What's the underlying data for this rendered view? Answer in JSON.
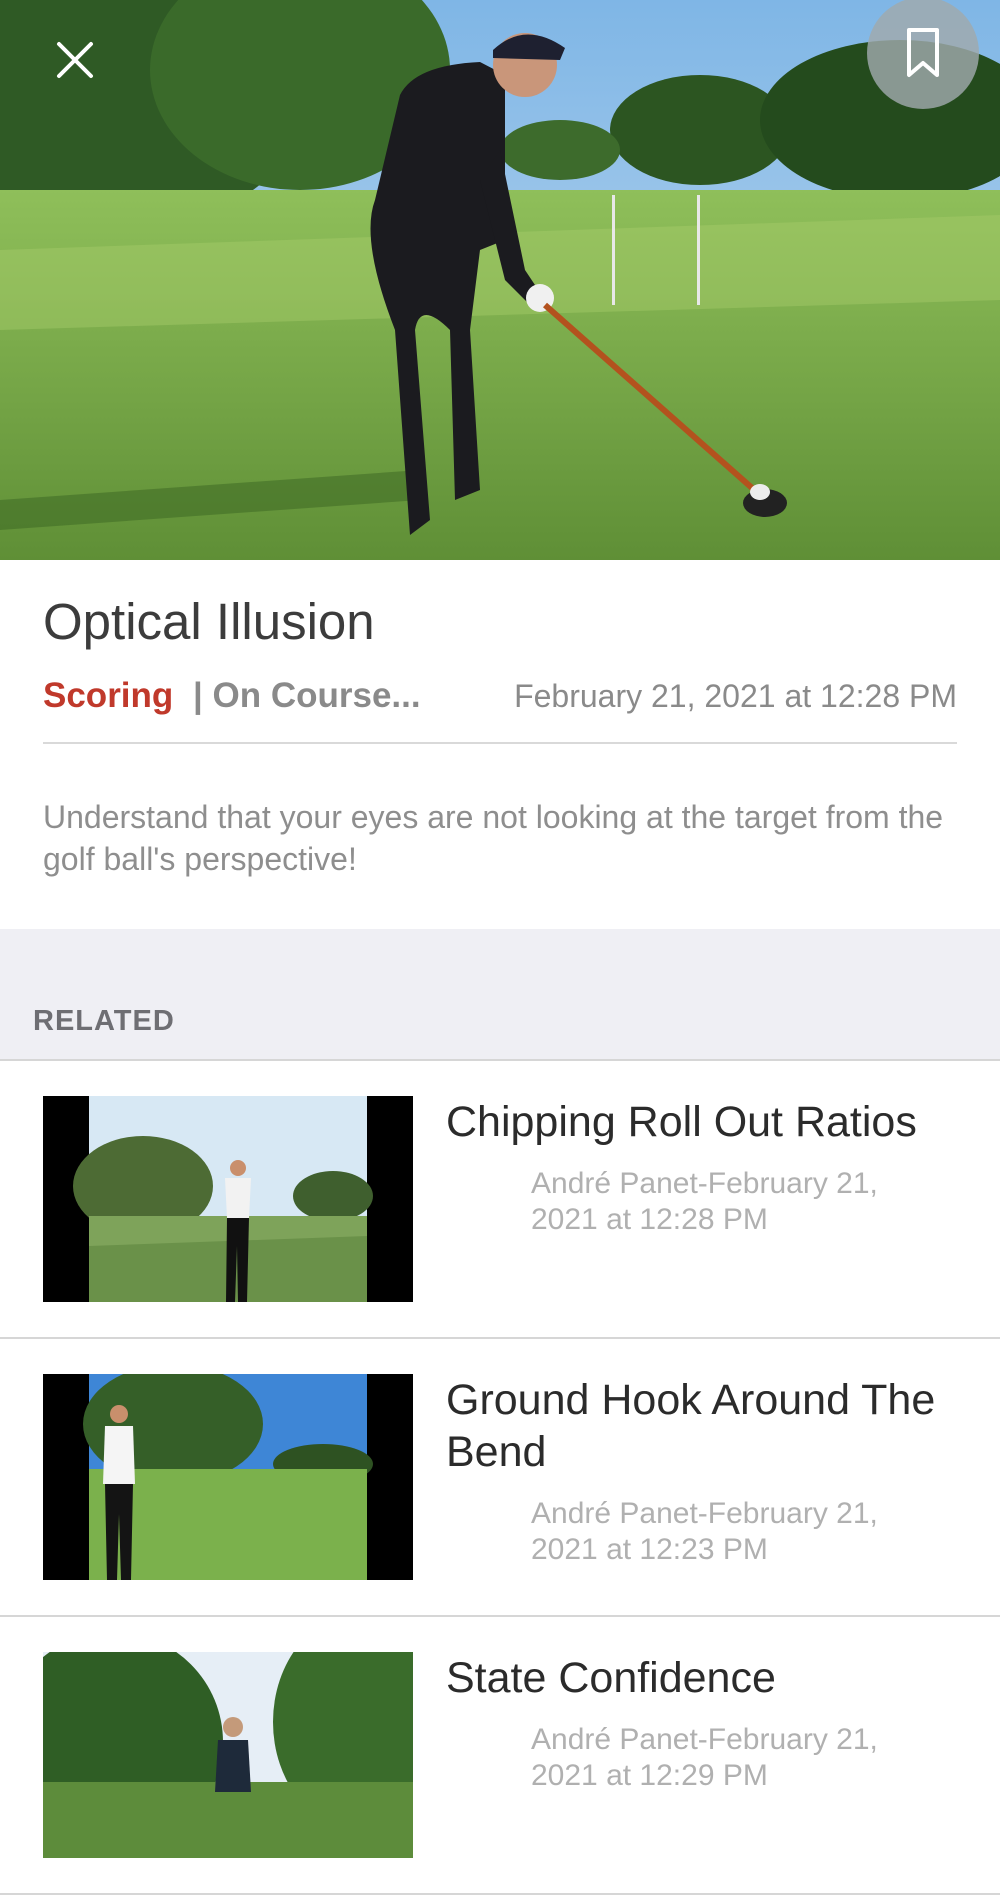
{
  "video": {
    "close_icon": "close-icon",
    "bookmark_icon": "bookmark-icon"
  },
  "detail": {
    "title": "Optical Illusion",
    "category": "Scoring",
    "subcategory": "| On Course...",
    "date": "February 21, 2021 at 12:28 PM",
    "description": "Understand that your eyes are not looking at the target from the golf ball's perspective!"
  },
  "related": {
    "header": "RELATED",
    "items": [
      {
        "title": "Chipping Roll Out Ratios",
        "meta": "André Panet-February 21, 2021 at 12:28 PM"
      },
      {
        "title": "Ground Hook Around The Bend",
        "meta": "André Panet-February 21, 2021 at 12:23 PM"
      },
      {
        "title": "State Confidence",
        "meta": "André Panet-February 21, 2021 at 12:29 PM"
      }
    ]
  },
  "colors": {
    "accent": "#c0392b",
    "section_bg": "#efeff4"
  }
}
